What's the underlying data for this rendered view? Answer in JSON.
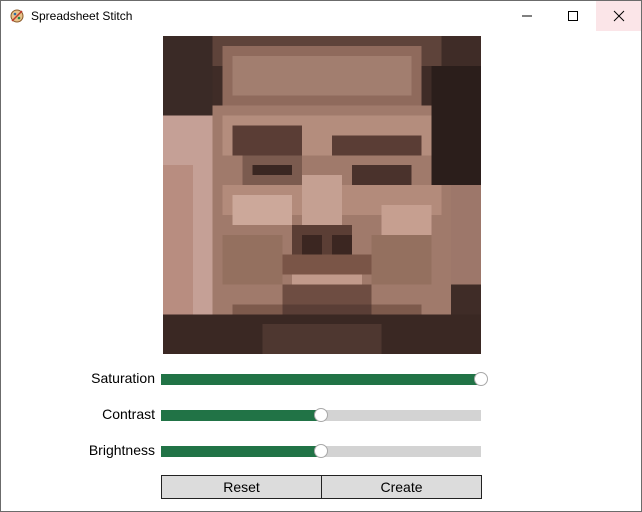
{
  "window": {
    "title": "Spreadsheet Stitch",
    "icon": "app-icon",
    "controls": [
      "minimize-icon",
      "maximize-icon",
      "close-icon"
    ]
  },
  "preview": {
    "alt": "pixelated face preview"
  },
  "sliders": [
    {
      "label": "Saturation",
      "value": 1.0
    },
    {
      "label": "Contrast",
      "value": 0.5
    },
    {
      "label": "Brightness",
      "value": 0.5
    }
  ],
  "buttons": {
    "reset_label": "Reset",
    "create_label": "Create"
  },
  "colors": {
    "slider_fill": "#217346",
    "slider_track": "#d3d3d3",
    "button_bg": "#dcdcdc",
    "close_hover": "#fbe5e8"
  }
}
